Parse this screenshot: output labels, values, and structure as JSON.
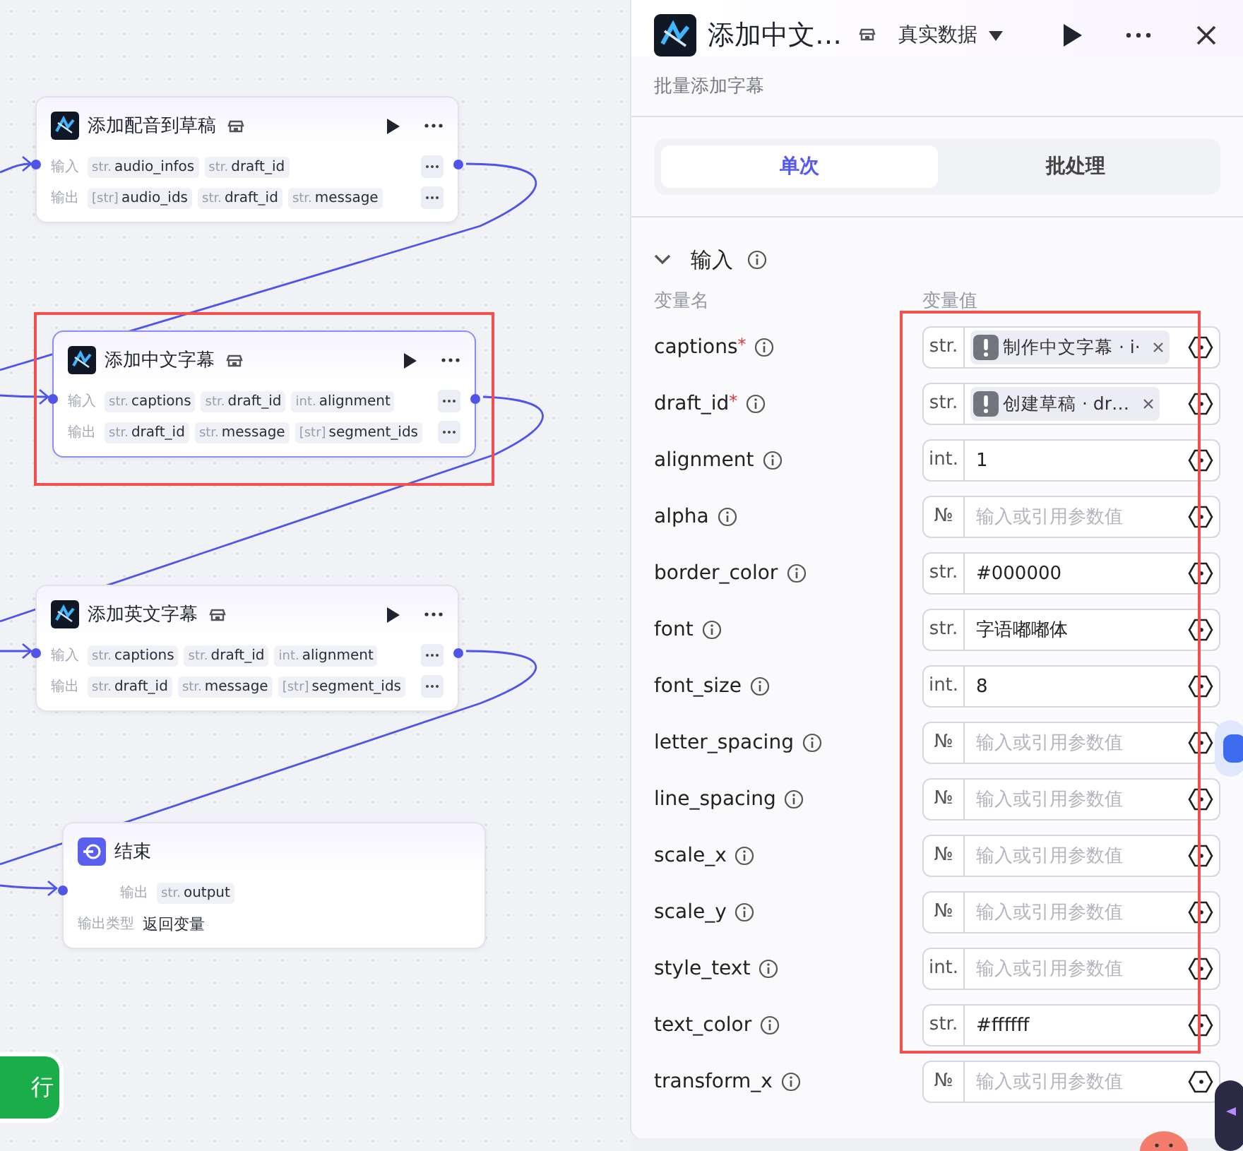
{
  "canvas": {
    "nodes": [
      {
        "kind": "plugin",
        "title": "添加配音到草稿",
        "selected": false,
        "highlighted": false,
        "input_label": "输入",
        "output_label": "输出",
        "inputs": [
          {
            "type": "str.",
            "name": "audio_infos"
          },
          {
            "type": "str.",
            "name": "draft_id"
          }
        ],
        "outputs": [
          {
            "type": "[str]",
            "name": "audio_ids"
          },
          {
            "type": "str.",
            "name": "draft_id"
          },
          {
            "type": "str.",
            "name": "message"
          }
        ]
      },
      {
        "kind": "plugin",
        "title": "添加中文字幕",
        "selected": true,
        "highlighted": true,
        "input_label": "输入",
        "output_label": "输出",
        "inputs": [
          {
            "type": "str.",
            "name": "captions"
          },
          {
            "type": "str.",
            "name": "draft_id"
          },
          {
            "type": "int.",
            "name": "alignment"
          }
        ],
        "outputs": [
          {
            "type": "str.",
            "name": "draft_id"
          },
          {
            "type": "str.",
            "name": "message"
          },
          {
            "type": "[str]",
            "name": "segment_ids"
          }
        ]
      },
      {
        "kind": "plugin",
        "title": "添加英文字幕",
        "selected": false,
        "highlighted": false,
        "input_label": "输入",
        "output_label": "输出",
        "inputs": [
          {
            "type": "str.",
            "name": "captions"
          },
          {
            "type": "str.",
            "name": "draft_id"
          },
          {
            "type": "int.",
            "name": "alignment"
          }
        ],
        "outputs": [
          {
            "type": "str.",
            "name": "draft_id"
          },
          {
            "type": "str.",
            "name": "message"
          },
          {
            "type": "[str]",
            "name": "segment_ids"
          }
        ]
      },
      {
        "kind": "end",
        "title": "结束",
        "selected": false,
        "highlighted": false,
        "output_label": "输出",
        "outputs": [
          {
            "type": "str.",
            "name": "output"
          }
        ],
        "output_type_label": "输出类型",
        "output_type": "返回变量"
      }
    ],
    "run_button": "行"
  },
  "panel": {
    "title": "添加中文…",
    "data_source": "真实数据",
    "description": "批量添加字幕",
    "tabs": [
      {
        "label": "单次",
        "selected": true
      },
      {
        "label": "批处理",
        "selected": false
      }
    ],
    "section": {
      "title": "输入",
      "expanded": true,
      "name_header": "变量名",
      "value_header": "变量值"
    },
    "params": [
      {
        "name": "captions",
        "required_mark": "*",
        "type": "str.",
        "kind": "ref",
        "value": "制作中文字幕 · i·",
        "highlighted": true
      },
      {
        "name": "draft_id",
        "required_mark": "*",
        "type": "str.",
        "kind": "ref",
        "value": "创建草稿 · dr…",
        "highlighted": true
      },
      {
        "name": "alignment",
        "type": "int.",
        "kind": "value",
        "value": "1",
        "highlighted": true
      },
      {
        "name": "alpha",
        "type": "№",
        "kind": "empty",
        "placeholder": "输入或引用参数值",
        "highlighted": true
      },
      {
        "name": "border_color",
        "type": "str.",
        "kind": "value",
        "value": "#000000",
        "highlighted": true
      },
      {
        "name": "font",
        "type": "str.",
        "kind": "value",
        "value": "字语嘟嘟体",
        "highlighted": true
      },
      {
        "name": "font_size",
        "type": "int.",
        "kind": "value",
        "value": "8",
        "highlighted": true
      },
      {
        "name": "letter_spacing",
        "type": "№",
        "kind": "empty",
        "placeholder": "输入或引用参数值",
        "highlighted": true
      },
      {
        "name": "line_spacing",
        "type": "№",
        "kind": "empty",
        "placeholder": "输入或引用参数值",
        "highlighted": true
      },
      {
        "name": "scale_x",
        "type": "№",
        "kind": "empty",
        "placeholder": "输入或引用参数值",
        "highlighted": true
      },
      {
        "name": "scale_y",
        "type": "№",
        "kind": "empty",
        "placeholder": "输入或引用参数值",
        "highlighted": true
      },
      {
        "name": "style_text",
        "type": "int.",
        "kind": "empty",
        "placeholder": "输入或引用参数值",
        "highlighted": true
      },
      {
        "name": "text_color",
        "type": "str.",
        "kind": "value",
        "value": "#ffffff",
        "highlighted": true
      },
      {
        "name": "transform_x",
        "type": "№",
        "kind": "empty",
        "placeholder": "输入或引用参数值"
      }
    ]
  }
}
